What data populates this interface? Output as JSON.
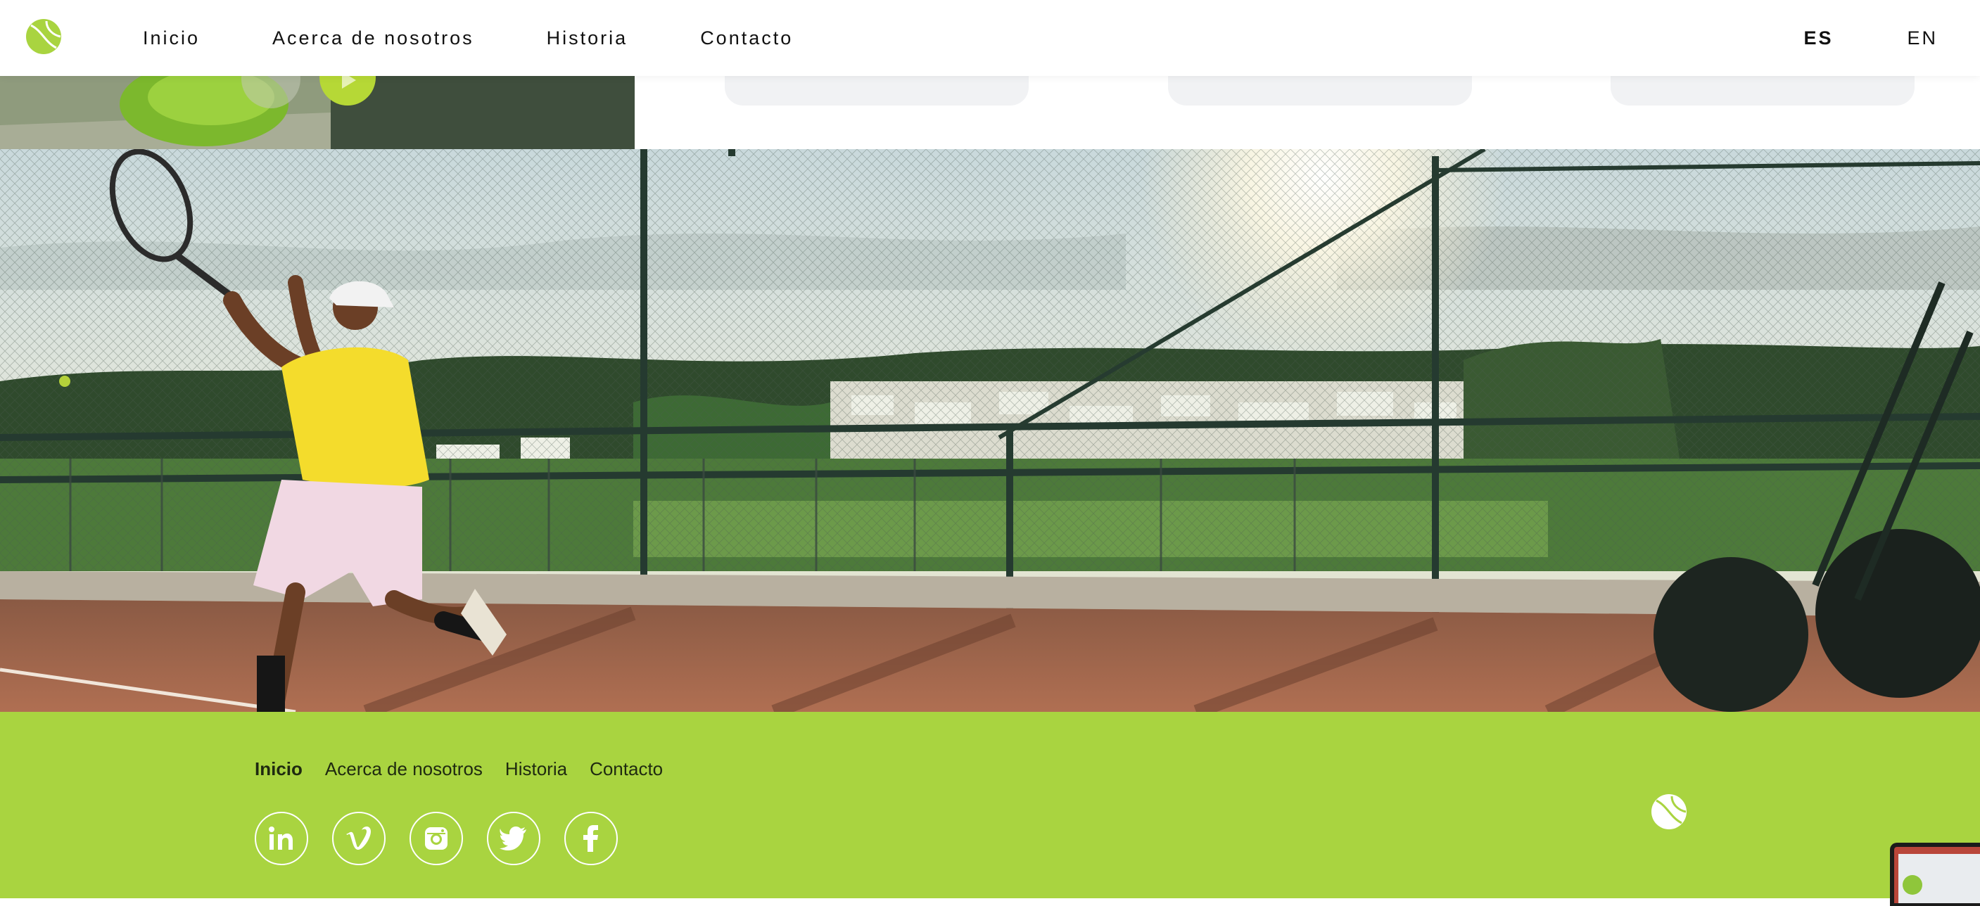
{
  "header": {
    "nav": [
      "Inicio",
      "Acerca de nosotros",
      "Historia",
      "Contacto"
    ],
    "languages": [
      {
        "label": "ES",
        "active": true
      },
      {
        "label": "EN",
        "active": false
      }
    ]
  },
  "footer": {
    "nav": [
      "Inicio",
      "Acerca de nosotros",
      "Historia",
      "Contacto"
    ],
    "active": "Inicio",
    "social": [
      "linkedin-icon",
      "vimeo-icon",
      "instagram-icon",
      "twitter-icon",
      "facebook-icon"
    ]
  },
  "colors": {
    "accent": "#a9d440",
    "text": "#111111",
    "card": "#f1f2f4"
  }
}
